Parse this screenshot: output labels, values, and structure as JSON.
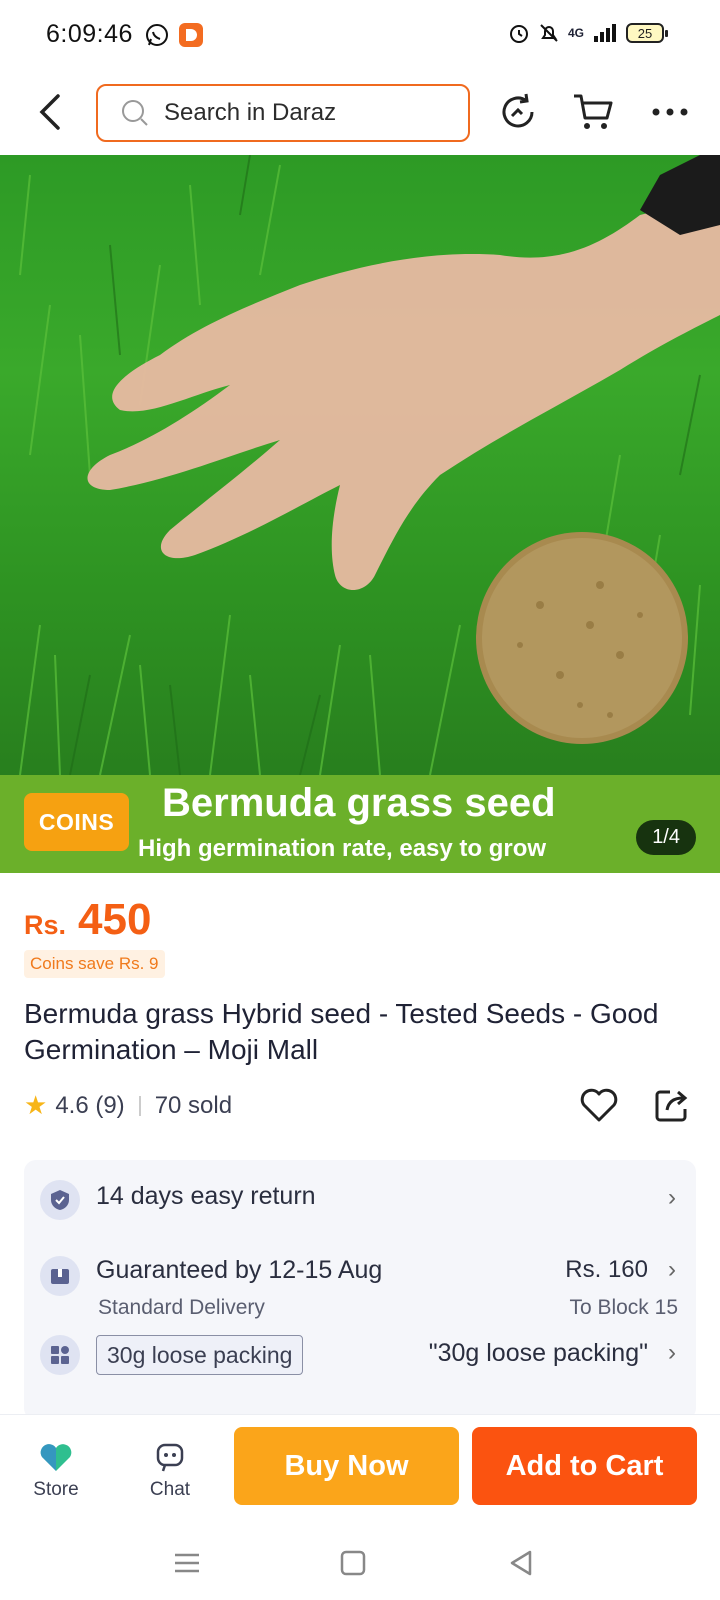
{
  "status_bar": {
    "time": "6:09:46",
    "network": "4G",
    "battery": "25"
  },
  "search": {
    "placeholder": "Search in Daraz"
  },
  "hero": {
    "banner_badge": "COINS",
    "banner_title": "Bermuda grass seed",
    "banner_subtitle": "High germination rate, easy to grow",
    "page_indicator": "1/4"
  },
  "product": {
    "currency": "Rs.",
    "price": "450",
    "coins_save": "Coins save Rs. 9",
    "title": "Bermuda grass Hybrid seed - Tested Seeds - Good Germination – Moji Mall",
    "rating": "4.6 (9)",
    "sold": "70 sold"
  },
  "services": {
    "return_label": "14 days easy return",
    "delivery_label": "Guaranteed by 12-15 Aug",
    "delivery_type": "Standard Delivery",
    "delivery_price": "Rs. 160",
    "delivery_to": "To Block 15",
    "variant_chip": "30g loose packing",
    "variant_value": "\"30g loose packing\""
  },
  "bottom_bar": {
    "store_label": "Store",
    "chat_label": "Chat",
    "buy_now_label": "Buy Now",
    "add_to_cart_label": "Add to Cart"
  },
  "colors": {
    "accent_orange": "#f45f14",
    "buy_now": "#fba51a",
    "add_to_cart": "#fb5310",
    "banner_green": "#6bb02a"
  }
}
